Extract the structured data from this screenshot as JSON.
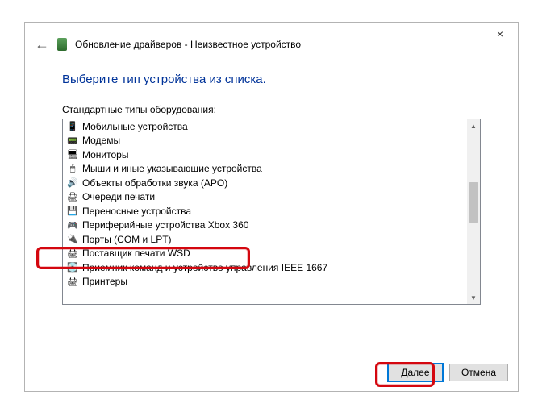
{
  "window": {
    "title": "Обновление драйверов - Неизвестное устройство",
    "close": "×"
  },
  "heading": "Выберите тип устройства из списка.",
  "section_label": "Стандартные типы оборудования:",
  "list": {
    "items": [
      {
        "icon": "📱",
        "label": "Мобильные устройства"
      },
      {
        "icon": "📟",
        "label": "Модемы"
      },
      {
        "icon": "🖥",
        "label": "Мониторы"
      },
      {
        "icon": "🖱",
        "label": "Мыши и иные указывающие устройства"
      },
      {
        "icon": "🔊",
        "label": "Объекты обработки звука (APO)"
      },
      {
        "icon": "🖨",
        "label": "Очереди печати"
      },
      {
        "icon": "💾",
        "label": "Переносные устройства"
      },
      {
        "icon": "🎮",
        "label": "Периферийные устройства Xbox 360"
      },
      {
        "icon": "🔌",
        "label": "Порты (COM и LPT)"
      },
      {
        "icon": "🖨",
        "label": "Поставщик печати WSD"
      },
      {
        "icon": "💽",
        "label": "Приемник команд и устройство управления IEEE 1667"
      },
      {
        "icon": "🖨",
        "label": "Принтеры"
      },
      {
        "icon": "",
        "label": ""
      }
    ]
  },
  "buttons": {
    "next": "Далее",
    "cancel": "Отмена"
  }
}
